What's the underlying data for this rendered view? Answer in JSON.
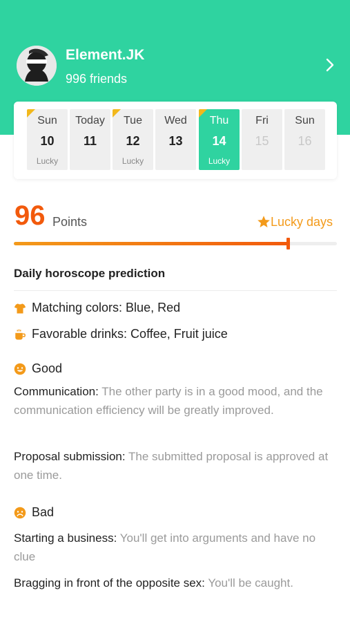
{
  "profile": {
    "username": "Element.JK",
    "friends": "996 friends"
  },
  "calendar": {
    "days": [
      {
        "name": "Sun",
        "num": "10",
        "lucky": "Lucky"
      },
      {
        "name": "Today",
        "num": "11",
        "lucky": ""
      },
      {
        "name": "Tue",
        "num": "12",
        "lucky": "Lucky"
      },
      {
        "name": "Wed",
        "num": "13",
        "lucky": ""
      },
      {
        "name": "Thu",
        "num": "14",
        "lucky": "Lucky"
      },
      {
        "name": "Fri",
        "num": "15",
        "lucky": ""
      },
      {
        "name": "Sun",
        "num": "16",
        "lucky": ""
      }
    ]
  },
  "score": {
    "points": "96",
    "points_label": "Points",
    "lucky_days_label": "Lucky days",
    "progress": 0.85
  },
  "horoscope": {
    "title": "Daily horoscope prediction",
    "colors": "Matching colors: Blue, Red",
    "drinks": "Favorable drinks: Coffee, Fruit juice",
    "good_label": "Good",
    "good_items": [
      {
        "label": "Communication:",
        "desc": "The other party is in a good mood, and the communication efficiency will be greatly improved."
      },
      {
        "label": "Proposal submission:",
        "desc": "The submitted proposal is approved at one time."
      }
    ],
    "bad_label": "Bad",
    "bad_items": [
      {
        "label": "Starting a business:",
        "desc": "You'll get into arguments and have no clue"
      },
      {
        "label": "Bragging in front of the opposite sex:",
        "desc": "You'll be caught."
      }
    ]
  },
  "colors": {
    "brand_green": "#2fd3a0",
    "accent_orange": "#f25a0c",
    "lucky_orange": "#f39a1a",
    "corner_yellow": "#f2b81c"
  }
}
